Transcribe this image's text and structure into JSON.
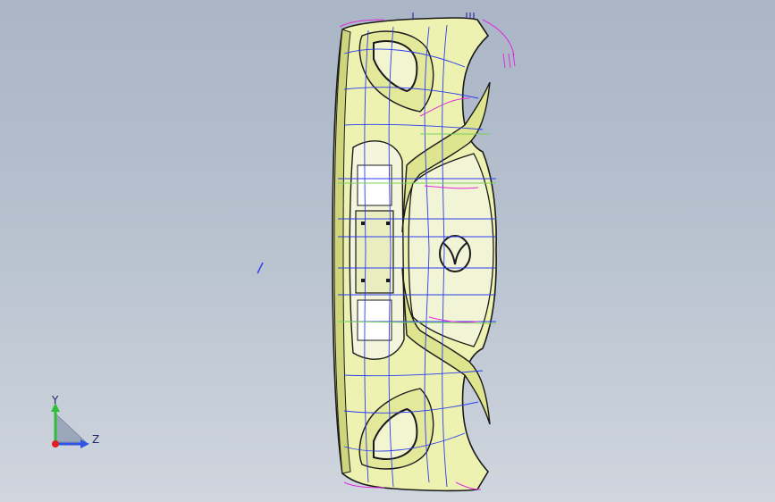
{
  "viewport": {
    "background_top": "#aab6c6",
    "background_bottom": "#d0d6de"
  },
  "model": {
    "fill_color": "#eef2b0",
    "shadow_color": "#c9cf6a",
    "edge_color": "#1a1a1a",
    "sketch_blue": "#2b3cf0",
    "sketch_magenta": "#e12bdc",
    "sketch_green": "#7ad05a"
  },
  "triad": {
    "y_label": "Y",
    "z_label": "Z",
    "y_color": "#2fbf3a",
    "z_color": "#2e55e6",
    "x_color": "#e02020",
    "cone_color": "#9aa7bb"
  }
}
